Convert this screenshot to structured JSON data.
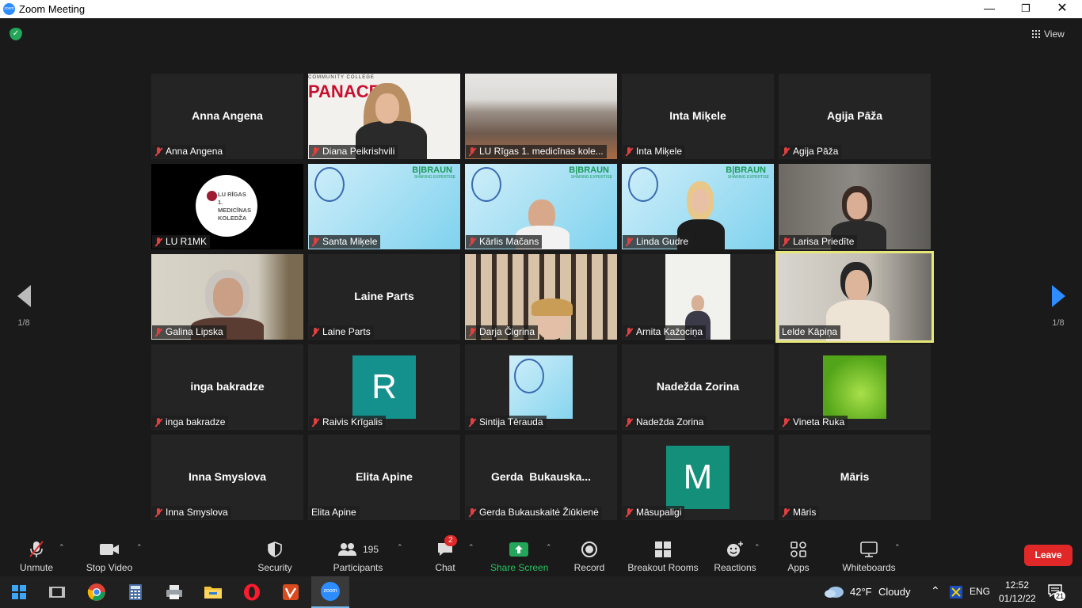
{
  "window": {
    "title": "Zoom Meeting",
    "min": "—",
    "max": "❐",
    "close": "✕",
    "icon_text": "zoom"
  },
  "top": {
    "view_label": "View"
  },
  "pager": {
    "left": "1/8",
    "right": "1/8"
  },
  "tiles": [
    {
      "label": "Anna Angena",
      "center": "Anna Angena",
      "muted": true
    },
    {
      "label": "Diana Peikrishvili",
      "muted": true,
      "banner": "PANACE",
      "banner_small": "COMMUNITY COLLEGE"
    },
    {
      "label": "LU Rīgas 1. medicīnas kole...",
      "muted": true
    },
    {
      "label": "Inta Miķele",
      "center": "Inta Miķele",
      "muted": true
    },
    {
      "label": "Agija Pāža",
      "center": "Agija Pāža",
      "muted": true
    },
    {
      "label": "LU R1MK",
      "muted": true,
      "logo": [
        "LU RĪGAS",
        "1. MEDICĪNAS",
        "KOLEDŽA"
      ]
    },
    {
      "label": "Santa Miķele",
      "muted": true,
      "brand": "B|BRAUN",
      "brand_sub": "SHARING EXPERTISE"
    },
    {
      "label": "Kārlis Mačans",
      "muted": true,
      "brand": "B|BRAUN",
      "brand_sub": "SHARING EXPERTISE"
    },
    {
      "label": "Linda Gudre",
      "muted": true,
      "brand": "B|BRAUN",
      "brand_sub": "SHARING EXPERTISE"
    },
    {
      "label": "Larisa Priedīte",
      "muted": true
    },
    {
      "label": "Galina Lipska",
      "muted": true
    },
    {
      "label": "Laine Parts",
      "center": "Laine Parts",
      "muted": true
    },
    {
      "label": "Darja Čigrina",
      "muted": true
    },
    {
      "label": "Arnita Kažociņa",
      "muted": true
    },
    {
      "label": "Lelde Kāpiņa",
      "muted": false
    },
    {
      "label": "inga bakradze",
      "center": "inga bakradze",
      "muted": true
    },
    {
      "label": "Raivis Krīgalis",
      "muted": true,
      "letter": "R"
    },
    {
      "label": "Sintija Tērauda",
      "muted": true
    },
    {
      "label": "Nadežda Zorina",
      "center": "Nadežda Zorina",
      "muted": true
    },
    {
      "label": "Vineta Ruka",
      "muted": true
    },
    {
      "label": "Inna Smyslova",
      "center": "Inna Smyslova",
      "muted": true
    },
    {
      "label": "Elita Apine",
      "center": "Elita Apine",
      "muted": false
    },
    {
      "label": "Gerda Bukauskaitė Žiūkienė",
      "center": "Gerda  Bukauska...",
      "muted": true
    },
    {
      "label": "Māsupaligi",
      "muted": true,
      "letter": "M"
    },
    {
      "label": "Māris",
      "center": "Māris",
      "muted": true
    }
  ],
  "toolbar": {
    "unmute": "Unmute",
    "stop_video": "Stop Video",
    "security": "Security",
    "participants": "Participants",
    "participants_count": "195",
    "chat": "Chat",
    "chat_badge": "2",
    "share": "Share Screen",
    "record": "Record",
    "breakout": "Breakout Rooms",
    "reactions": "Reactions",
    "apps": "Apps",
    "whiteboards": "Whiteboards",
    "leave": "Leave"
  },
  "taskbar": {
    "weather_temp": "42°F",
    "weather_desc": "Cloudy",
    "lang": "ENG",
    "time": "12:52",
    "date": "01/12/22",
    "notif_count": "21",
    "zoom_text": "zoom"
  },
  "colors": {
    "zoom_blue": "#2d8cff",
    "leave_red": "#e02828",
    "active_speaker": "#e6e67a",
    "share_green": "#23a55a"
  }
}
